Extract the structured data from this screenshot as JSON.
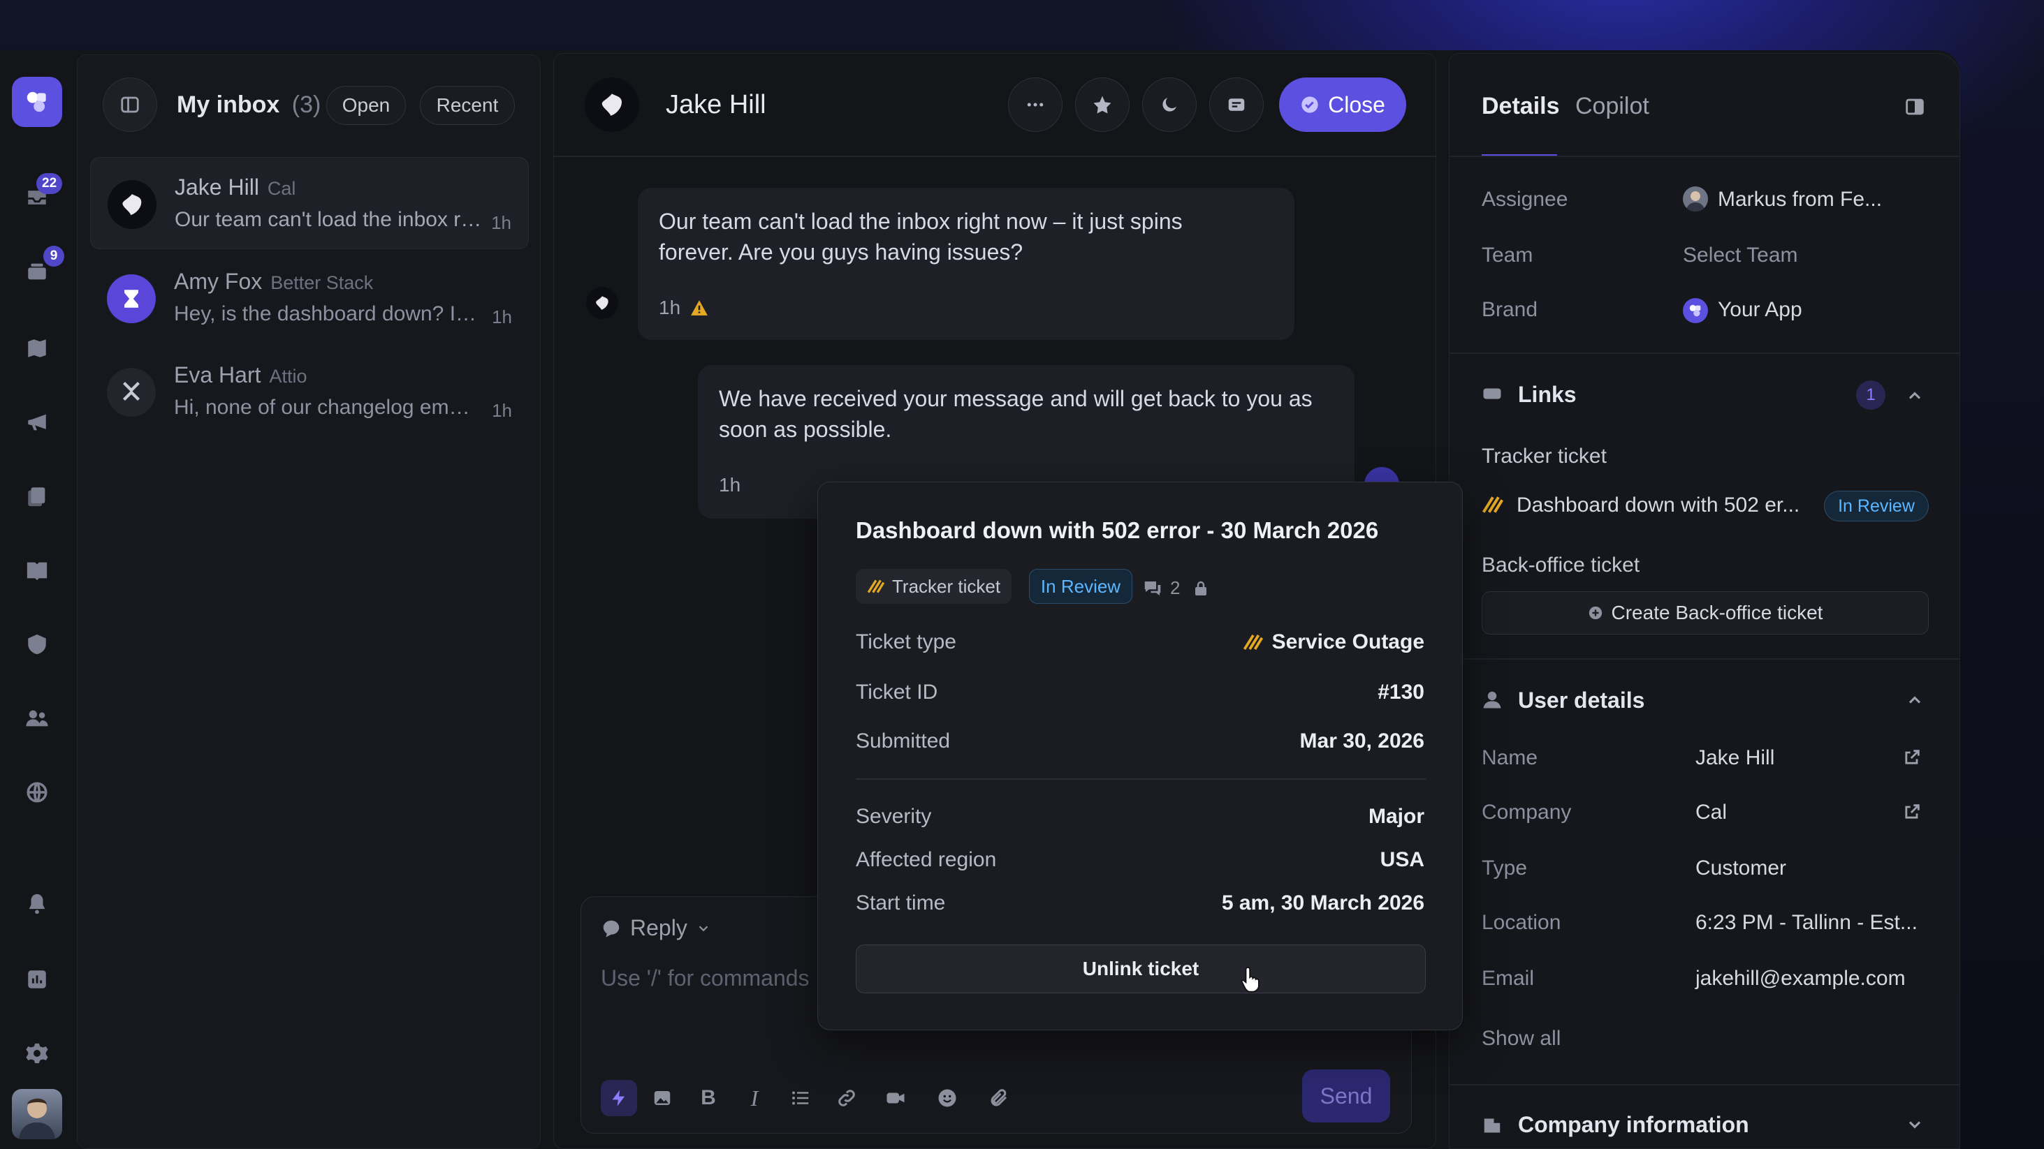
{
  "colors": {
    "accent": "#5b50e0",
    "badge": "#4f46c8",
    "in_review": "#5cb6ff",
    "warning": "#e5a823"
  },
  "rail": {
    "inbox_badge": "22",
    "tickets_badge": "9",
    "icons": [
      "app-logo-icon",
      "inbox-icon",
      "tickets-icon",
      "map-icon",
      "megaphone-icon",
      "docs-icon",
      "book-icon",
      "shield-icon",
      "people-icon",
      "globe-icon",
      "bell-icon",
      "chart-icon",
      "gear-icon",
      "user-avatar"
    ]
  },
  "inbox": {
    "title": "My inbox",
    "count": "(3)",
    "filter_open": "Open",
    "filter_recent": "Recent",
    "conversations": [
      {
        "name": "Jake Hill",
        "org": "Cal",
        "preview": "Our team can't load the inbox right now – it just spins forever.",
        "time": "1h"
      },
      {
        "name": "Amy Fox",
        "org": "Better Stack",
        "preview": "Hey, is the dashboard down? It won't load.",
        "time": "1h"
      },
      {
        "name": "Eva Hart",
        "org": "Attio",
        "preview": "Hi, none of our changelog emails went out.",
        "time": "1h"
      }
    ]
  },
  "conversation": {
    "contact_name": "Jake Hill",
    "close_label": "Close",
    "messages": [
      {
        "text": "Our team can't load the inbox right now – it just spins forever. Are you guys having issues?",
        "time": "1h"
      },
      {
        "text": "We have received your message and will get back to you as soon as possible.",
        "time": "1h"
      }
    ],
    "composer": {
      "mode": "Reply",
      "placeholder": "Use '/' for commands",
      "send_label": "Send"
    }
  },
  "popover": {
    "title": "Dashboard down with 502 error - 30 March 2026",
    "tag_type": "Tracker ticket",
    "tag_status": "In Review",
    "comment_count": "2",
    "rows_top": [
      {
        "label": "Ticket type",
        "value": "Service Outage"
      },
      {
        "label": "Ticket ID",
        "value": "#130"
      },
      {
        "label": "Submitted",
        "value": "Mar 30, 2026"
      }
    ],
    "rows_bottom": [
      {
        "label": "Severity",
        "value": "Major"
      },
      {
        "label": "Affected region",
        "value": "USA"
      },
      {
        "label": "Start time",
        "value": "5 am, 30 March 2026"
      }
    ],
    "unlink_label": "Unlink ticket"
  },
  "details": {
    "tab_details": "Details",
    "tab_copilot": "Copilot",
    "assignee_label": "Assignee",
    "assignee_value": "Markus from Fe...",
    "team_label": "Team",
    "team_value": "Select Team",
    "brand_label": "Brand",
    "brand_value": "Your App",
    "links": {
      "title": "Links",
      "count": "1",
      "tracker_label": "Tracker ticket",
      "tracker_title": "Dashboard down with 502 er...",
      "tracker_status": "In Review",
      "backoffice_label": "Back-office ticket",
      "create_backoffice": "Create Back-office ticket"
    },
    "user": {
      "title": "User details",
      "name_label": "Name",
      "name_value": "Jake Hill",
      "company_label": "Company",
      "company_value": "Cal",
      "type_label": "Type",
      "type_value": "Customer",
      "location_label": "Location",
      "location_value": "6:23 PM - Tallinn - Est...",
      "email_label": "Email",
      "email_value": "jakehill@example.com",
      "show_all": "Show all"
    },
    "company_title": "Company information"
  }
}
